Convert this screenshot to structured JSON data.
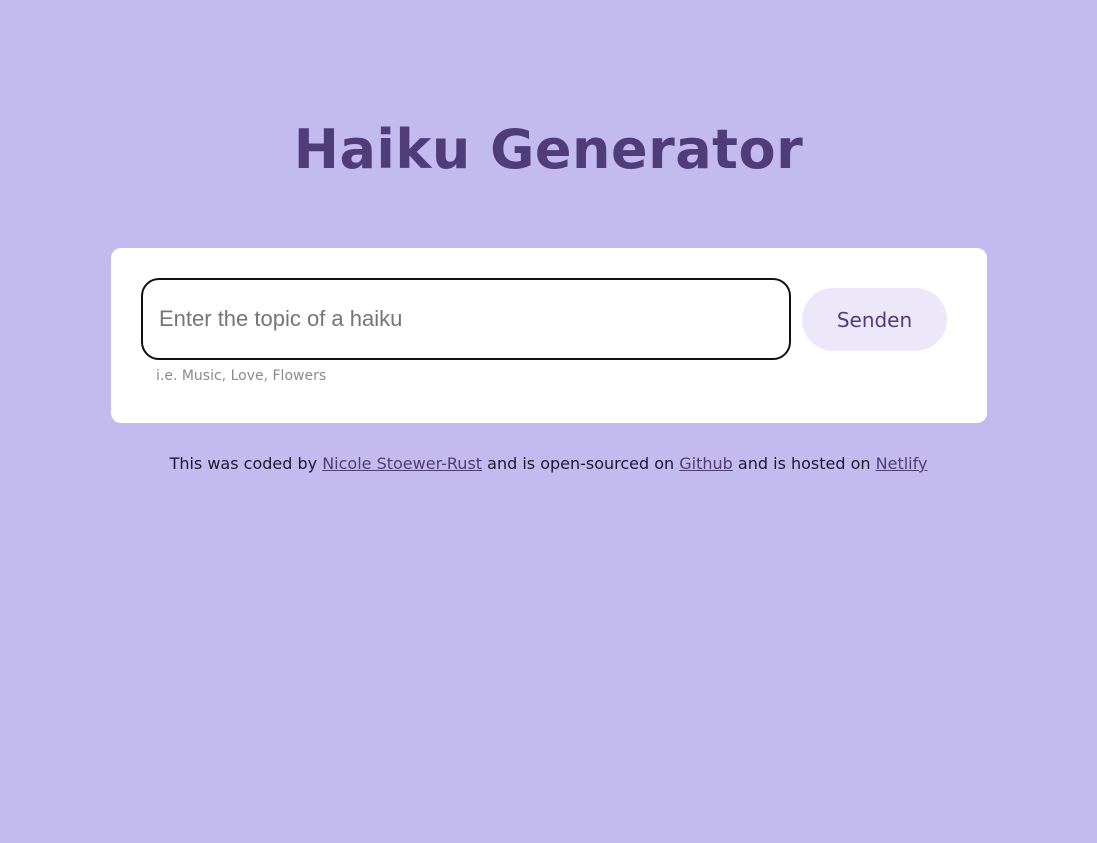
{
  "header": {
    "title": "Haiku Generator"
  },
  "form": {
    "input_placeholder": "Enter the topic of a haiku",
    "input_value": "",
    "submit_label": "Senden",
    "hint": "i.e. Music, Love, Flowers"
  },
  "footer": {
    "text_1": "This was coded by ",
    "author_link": "Nicole Stoewer-Rust",
    "text_2": " and is open-sourced on ",
    "github_link": "Github",
    "text_3": " and is hosted on ",
    "netlify_link": "Netlify"
  },
  "colors": {
    "background": "#c3baf0",
    "accent": "#4f3c78",
    "button_bg": "#ece8f9",
    "card_bg": "#ffffff"
  }
}
